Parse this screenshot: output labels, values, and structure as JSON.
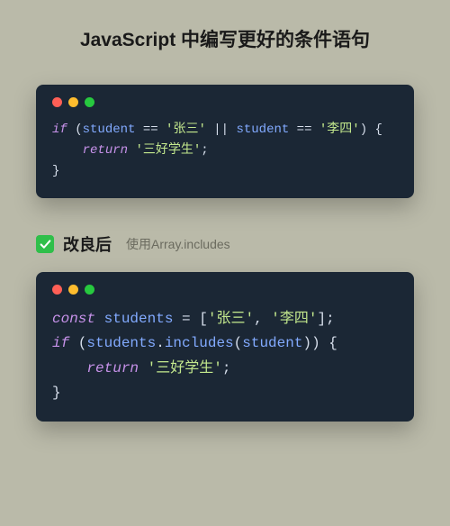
{
  "title": "JavaScript 中编写更好的条件语句",
  "block1": {
    "line1": {
      "kw1": "if",
      "p1": " (",
      "id1": "student",
      "p2": " == ",
      "str1": "'张三'",
      "p3": " || ",
      "id2": "student",
      "p4": " == ",
      "str2": "'李四'",
      "p5": ") {"
    },
    "line2": {
      "indent": "    ",
      "kw": "return",
      "sp": " ",
      "str": "'三好学生'",
      "p": ";"
    },
    "line3": {
      "p": "}"
    }
  },
  "improved": {
    "label": "改良后",
    "subtitle": "使用Array.includes"
  },
  "block2": {
    "line1": {
      "kw": "const",
      "sp": " ",
      "id": "students",
      "p1": " = [",
      "str1": "'张三'",
      "p2": ", ",
      "str2": "'李四'",
      "p3": "];"
    },
    "line2": {
      "kw": "if",
      "p1": " (",
      "id1": "students",
      "p2": ".",
      "fn": "includes",
      "p3": "(",
      "id2": "student",
      "p4": ")) {"
    },
    "line3": {
      "indent": "    ",
      "kw": "return",
      "sp": " ",
      "str": "'三好学生'",
      "p": ";"
    },
    "line4": {
      "p": "}"
    }
  }
}
